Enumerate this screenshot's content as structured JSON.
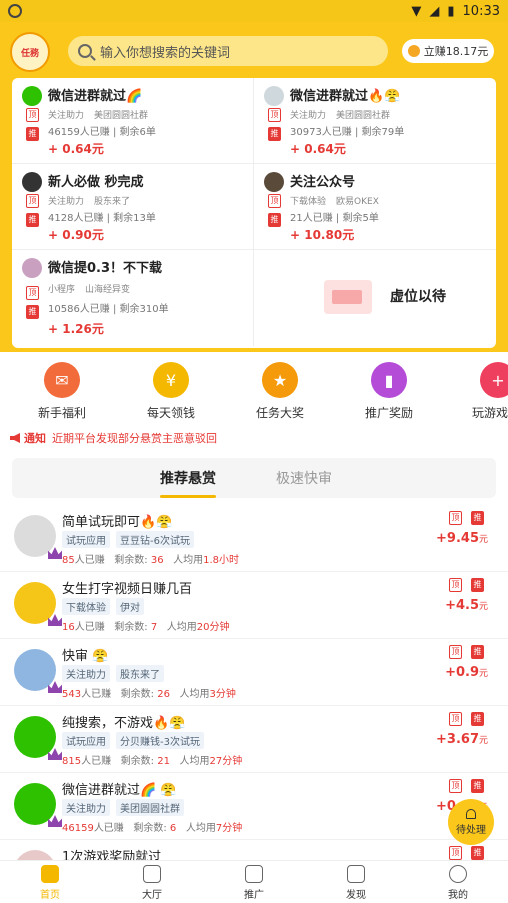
{
  "status": {
    "time": "10:33"
  },
  "header": {
    "logo_text": "任務",
    "search_placeholder": "输入你想搜索的关键词",
    "balance": "立赚18.17元"
  },
  "grid": [
    {
      "title": "微信进群就过🌈",
      "tag1": "关注助力",
      "tag2": "美团圆圆社群",
      "stat": "46159人已赚 | 剩余6单",
      "price": "+ 0.64元",
      "badge1": "顶",
      "badge2": "推"
    },
    {
      "title": "微信进群就过🔥😤",
      "tag1": "关注助力",
      "tag2": "美团圆圆社群",
      "stat": "30973人已赚 | 剩余79单",
      "price": "+ 0.64元",
      "badge1": "顶",
      "badge2": "推"
    },
    {
      "title": "新人必做 秒完成",
      "tag1": "关注助力",
      "tag2": "股东来了",
      "stat": "4128人已赚 | 剩余13单",
      "price": "+ 0.90元",
      "badge1": "顶",
      "badge2": "推"
    },
    {
      "title": "关注公众号",
      "tag1": "下载体验",
      "tag2": "欧易OKEX",
      "stat": "21人已赚 | 剩余5单",
      "price": "+ 10.80元",
      "badge1": "顶",
      "badge2": "推"
    },
    {
      "title": "微信提0.3！不下载",
      "tag1": "小程序",
      "tag2": "山海经异变",
      "stat": "10586人已赚 | 剩余310单",
      "price": "+ 1.26元",
      "badge1": "顶",
      "badge2": "推"
    }
  ],
  "placeholder_text": "虚位以待",
  "quick_nav": [
    {
      "label": "新手福利",
      "color": "#f26b3a"
    },
    {
      "label": "每天领钱",
      "color": "#f5b800"
    },
    {
      "label": "任务大奖",
      "color": "#f59a0b"
    },
    {
      "label": "推广奖励",
      "color": "#b44cd8"
    },
    {
      "label": "玩游戏",
      "color": "#ef3f5e"
    }
  ],
  "notice": {
    "label": "通知",
    "text": "近期平台发现部分悬赏主恶意驳回"
  },
  "tabs": {
    "active": "推荐悬赏",
    "inactive": "极速快审"
  },
  "list": [
    {
      "title": "简单试玩即可🔥😤",
      "tags": [
        "试玩应用",
        "豆豆钻-6次试玩"
      ],
      "earned": "85",
      "remain": "36",
      "avg": "1.8小时",
      "price": "+9.45",
      "unit": "元",
      "color": "#dcdcdc"
    },
    {
      "title": "女生打字视频日赚几百",
      "tags": [
        "下载体验",
        "伊对"
      ],
      "earned": "16",
      "remain": "7",
      "avg": "20分钟",
      "price": "+4.5",
      "unit": "元",
      "color": "#f5c518"
    },
    {
      "title": "快审 😤",
      "tags": [
        "关注助力",
        "股东来了"
      ],
      "earned": "543",
      "remain": "26",
      "avg": "3分钟",
      "price": "+0.9",
      "unit": "元",
      "color": "#8fb6e0"
    },
    {
      "title": "纯搜索，不游戏🔥😤",
      "tags": [
        "试玩应用",
        "分贝赚钱-3次试玩"
      ],
      "earned": "815",
      "remain": "21",
      "avg": "27分钟",
      "price": "+3.67",
      "unit": "元",
      "color": "#2dc100"
    },
    {
      "title": "微信进群就过🌈 😤",
      "tags": [
        "关注助力",
        "美团圆圆社群"
      ],
      "earned": "46159",
      "remain": "6",
      "avg": "7分钟",
      "price": "+0.64",
      "unit": "元",
      "color": "#2dc100"
    },
    {
      "title": "1次游戏奖励就过",
      "tags": [],
      "earned": "",
      "remain": "",
      "avg": "",
      "price": "",
      "unit": "",
      "color": "#e8c9c9"
    }
  ],
  "list_labels": {
    "earned": "人已赚",
    "remain": "剩余数: ",
    "avg": "人均用",
    "badge1": "顶",
    "badge2": "推"
  },
  "float_button": "待处理",
  "bottom_nav": [
    "首页",
    "大厅",
    "推广",
    "发现",
    "我的"
  ]
}
